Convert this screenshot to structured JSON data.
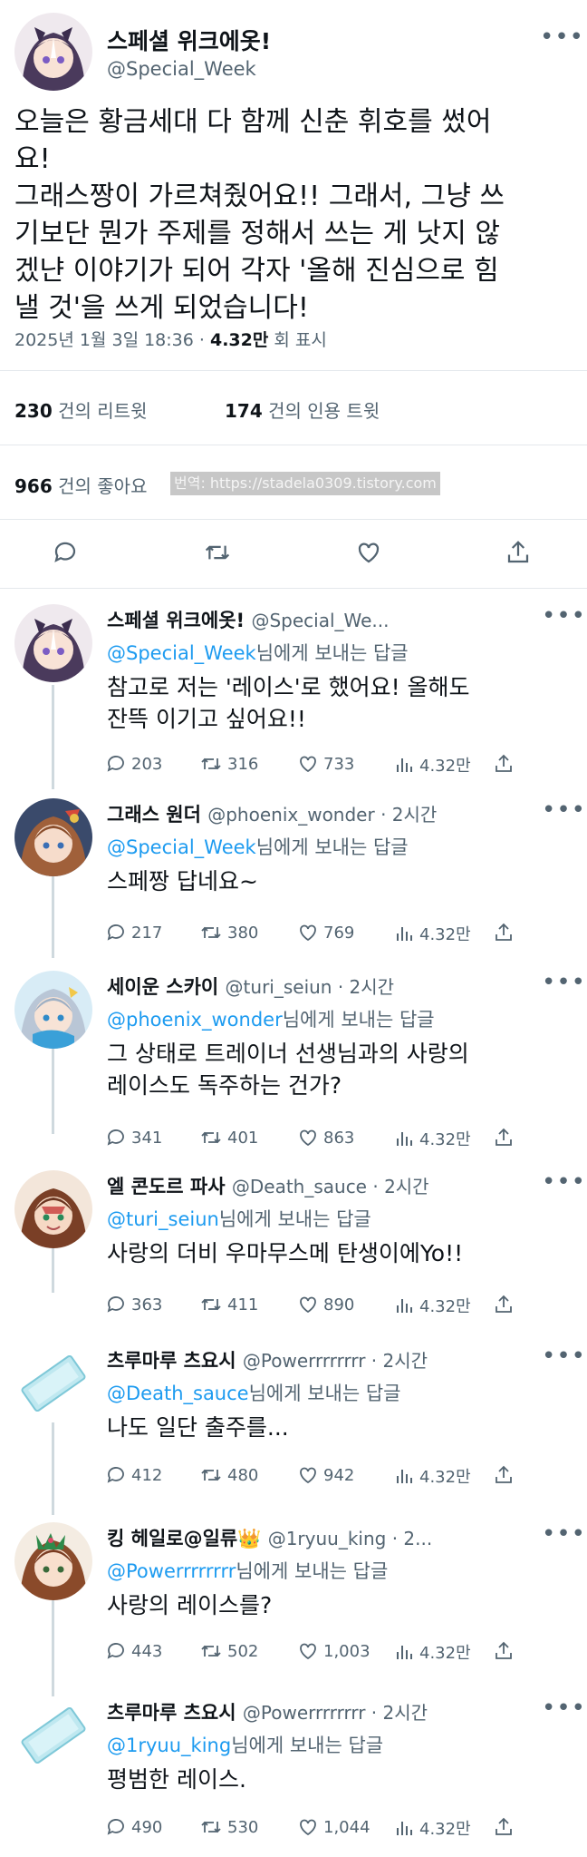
{
  "main_tweet": {
    "display_name": "스페셜 위크에옷!",
    "handle": "@Special_Week",
    "text": "오늘은 황금세대 다 함께 신춘 휘호를 썼어\n요!\n그래스짱이 가르쳐줬어요!! 그래서, 그냥 쓰\n기보단 뭔가 주제를 정해서 쓰는 게 낫지 않\n겠냔 이야기가 되어 각자 '올해 진심으로 힘\n낼 것'을 쓰게 되었습니다!",
    "timestamp": "2025년 1월 3일 18:36 ·",
    "views": "4.32만",
    "views_label": "회 표시",
    "retweets": "230",
    "retweets_label": "건의 리트윗",
    "quotes": "174",
    "quotes_label": "건의 인용 트윗",
    "likes": "966",
    "likes_label": "건의 좋아요",
    "more": "•••"
  },
  "watermark": "번역: https://stadela0309.tistory.com",
  "reply_suffix": "님에게 보내는 답글",
  "replies": [
    {
      "display_name": "스페셜 위크에옷!",
      "handle": "@Special_We...",
      "reply_to": "@Special_Week",
      "text": "참고로 저는 '레이스'로 했어요! 올해도\n잔뜩 이기고 싶어요!!",
      "replies": "203",
      "retweets": "316",
      "likes": "733",
      "views": "4.32만"
    },
    {
      "display_name": "그래스 원더",
      "handle": "@phoenix_wonder · 2시간",
      "reply_to": "@Special_Week",
      "text": "스페짱 답네요~",
      "replies": "217",
      "retweets": "380",
      "likes": "769",
      "views": "4.32만"
    },
    {
      "display_name": "세이운 스카이",
      "handle": "@turi_seiun · 2시간",
      "reply_to": "@phoenix_wonder",
      "text": "그 상태로 트레이너 선생님과의 사랑의\n레이스도 독주하는 건가?",
      "replies": "341",
      "retweets": "401",
      "likes": "863",
      "views": "4.32만"
    },
    {
      "display_name": "엘 콘도르 파사",
      "handle": "@Death_sauce · 2시간",
      "reply_to": "@turi_seiun",
      "text": "사랑의 더비 우마무스메 탄생이에Yo!!",
      "replies": "363",
      "retweets": "411",
      "likes": "890",
      "views": "4.32만"
    },
    {
      "display_name": "츠루마루 츠요시",
      "handle": "@Powerrrrrrrr · 2시간",
      "reply_to": "@Death_sauce",
      "text": "나도 일단 출주를...",
      "replies": "412",
      "retweets": "480",
      "likes": "942",
      "views": "4.32만"
    },
    {
      "display_name": "킹 헤일로@일류👑",
      "handle": "@1ryuu_king · 2...",
      "reply_to": "@Powerrrrrrrr",
      "text": "사랑의 레이스를?",
      "replies": "443",
      "retweets": "502",
      "likes": "1,003",
      "views": "4.32만"
    },
    {
      "display_name": "츠루마루 츠요시",
      "handle": "@Powerrrrrrrr · 2시간",
      "reply_to": "@1ryuu_king",
      "text": "평범한 레이스.",
      "replies": "490",
      "retweets": "530",
      "likes": "1,044",
      "views": "4.32만"
    }
  ],
  "colors": {
    "accent": "#1d9bf0",
    "secondary_text": "#536471",
    "divider": "#e4e8ec"
  },
  "icons": [
    "reply-icon",
    "retweet-icon",
    "like-icon",
    "share-icon",
    "views-icon",
    "more-icon"
  ]
}
